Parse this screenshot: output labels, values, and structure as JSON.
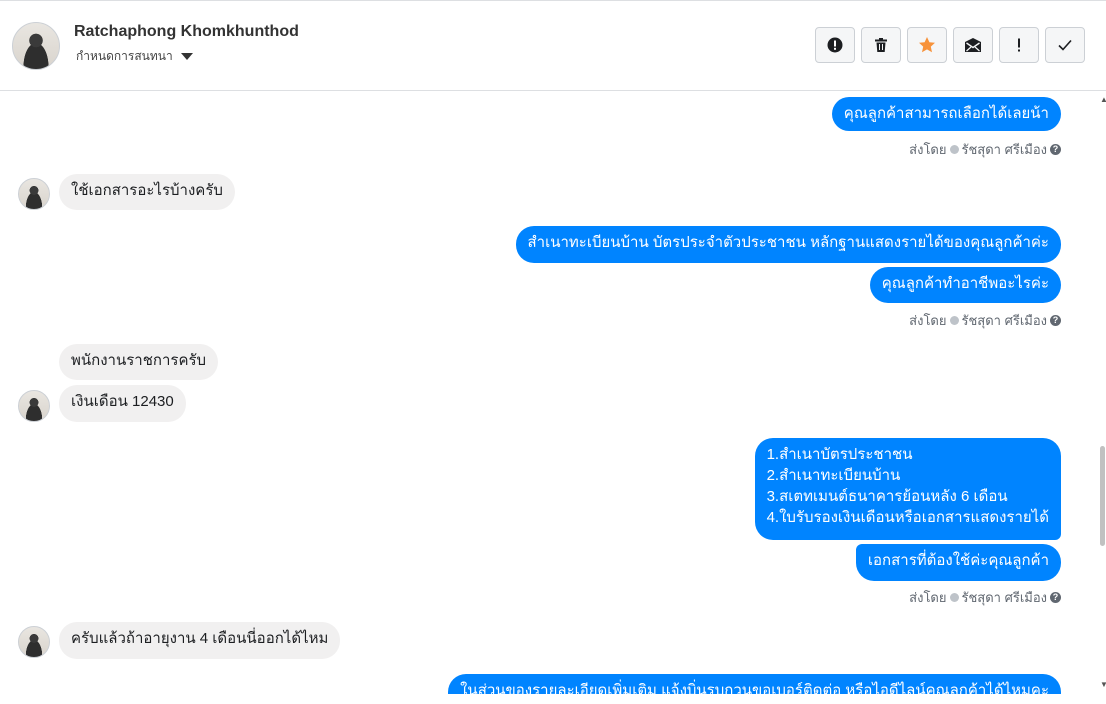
{
  "header": {
    "contact_name": "Ratchaphong Khomkhunthod",
    "label_dropdown": "กำหนดการสนทนา",
    "actions": [
      {
        "name": "spam",
        "icon": "alert-circle-icon"
      },
      {
        "name": "delete",
        "icon": "trash-icon"
      },
      {
        "name": "star",
        "icon": "star-icon"
      },
      {
        "name": "mark-unread",
        "icon": "envelope-icon"
      },
      {
        "name": "follow-up",
        "icon": "exclamation-icon"
      },
      {
        "name": "done",
        "icon": "check-icon"
      }
    ]
  },
  "colors": {
    "accent_blue": "#0084ff",
    "star_orange": "#f7923a",
    "incoming_bubble": "#f1f0f0"
  },
  "messages": {
    "m1": "คุณลูกค้าสามารถเลือกได้เลยน้า",
    "sent1": "ส่งโดย",
    "agent1": "รัชสุดา ศรีเมือง",
    "m2": "ใช้เอกสารอะไรบ้างครับ",
    "m3": "สำเนาทะเบียนบ้าน บัตรประจำตัวประชาชน หลักฐานแสดงรายได้ของคุณลูกค้าค่ะ",
    "m4": "คุณลูกค้าทำอาชีพอะไรค่ะ",
    "sent2": "ส่งโดย",
    "agent2": "รัชสุดา ศรีเมือง",
    "m5": "พนักงานราชการครับ",
    "m6": "เงินเดือน 12430",
    "m7": "1.สำเนาบัตรประชาชน\n2.สำเนาทะเบียนบ้าน\n3.สเตทเมนต์ธนาคารย้อนหลัง 6 เดือน\n4.ใบรับรองเงินเดือนหรือเอกสารแสดงรายได้",
    "m8": "เอกสารที่ต้องใช้ค่ะคุณลูกค้า",
    "sent3": "ส่งโดย",
    "agent3": "รัชสุดา ศรีเมือง",
    "m9": "ครับแล้วถ้าอายุงาน 4 เดือนนี่ออกได้ไหม",
    "m10": "ในส่วนของรายละเอียดเพิ่มเติม แจ้งบิ่นรบกวนขอเบอร์ติดต่อ หรือไอดีไลน์คุณลูกค้าได้ไหมคะ"
  }
}
